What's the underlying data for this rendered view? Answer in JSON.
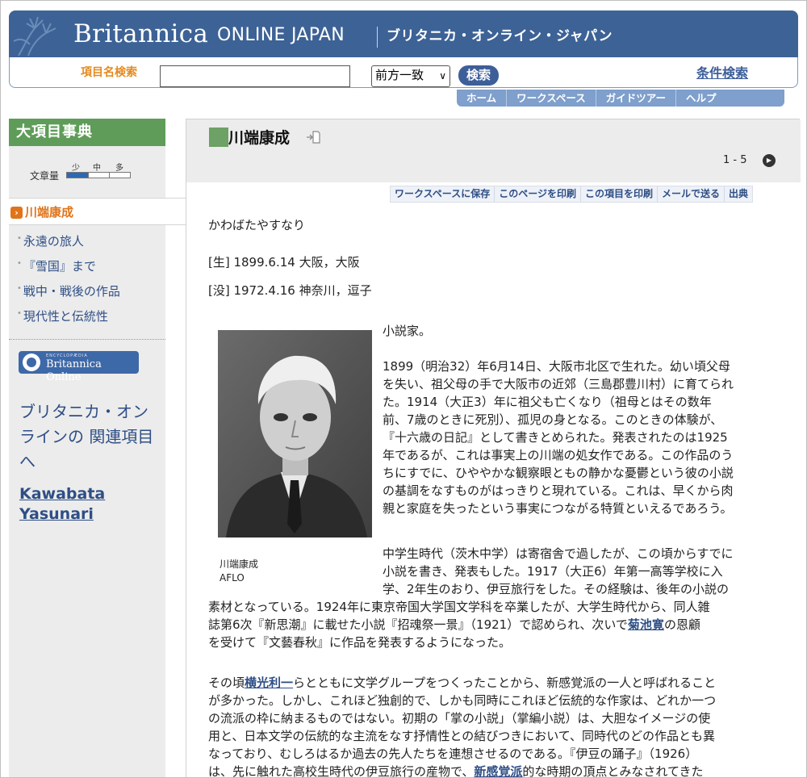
{
  "header": {
    "brand": "Britannica",
    "brand_sub": "ONLINE JAPAN",
    "brand_jp": "ブリタニカ・オンライン・ジャパン"
  },
  "search": {
    "label": "項目名検索",
    "value": "",
    "mode": "前方一致",
    "button": "検索",
    "advanced": "条件検索"
  },
  "nav": [
    "ホーム",
    "ワークスペース",
    "ガイドツアー",
    "ヘルプ"
  ],
  "sidebar": {
    "header": "大項目事典",
    "volume_label": "文章量",
    "volume_marks": [
      "少",
      "中",
      "多"
    ],
    "volume_level": 0.33,
    "current": "川端康成",
    "items": [
      "永遠の旅人",
      "『雪国』まで",
      "戦中・戦後の作品",
      "現代性と伝統性"
    ],
    "logo_small": "ENCYCLOPÆDIA",
    "logo_text": "Britannica Online",
    "related_text": "ブリタニカ・オンラインの 関連項目へ",
    "english_link": "Kawabata Yasunari"
  },
  "article": {
    "title": "川端康成",
    "pager": "1 - 5",
    "actions": [
      "ワークスペースに保存",
      "このページを印刷",
      "この項目を印刷",
      "メールで送る",
      "出典"
    ],
    "reading": "かわばたやすなり",
    "born": "[生] 1899.6.14 大阪，大阪",
    "died": "[没] 1972.4.16 神奈川，逗子",
    "caption_name": "川端康成",
    "caption_credit": "AFLO",
    "p0": "小説家。",
    "p1_lines": [
      "1899（明治32）年6月14日、大阪市北区で生れた。幼い頃父母",
      "を失い、祖父母の手で大阪市の近郊（三島郡豊川村）に育てられ",
      "た。1914（大正3）年に祖父も亡くなり（祖母とはその数年",
      "前、7歳のときに死別）、孤児の身となる。このときの体験が、",
      "『十六歳の日記』として書きとめられた。発表されたのは1925",
      "年であるが、これは事実上の川端の処女作である。この作品のう",
      "ちにすでに、ひややかな観察眼ともの静かな憂鬱という彼の小説",
      "の基調をなすものがはっきりと現れている。これは、早くから肉",
      "親と家庭を失ったという事実につながる特質といえるであろう。"
    ],
    "p2_lines": [
      "中学生時代（茨木中学）は寄宿舎で過したが、この頃からすでに",
      "小説を書き、発表もした。1917（大正6）年第一高等学校に入",
      "学、2年生のおり、伊豆旅行をした。その経験は、後年の小説の",
      "素材となっている。1924年に東京帝国大学国文学科を卒業したが、大学生時代から、同人雑",
      "誌第6次『新思潮』に載せた小説『招魂祭一景』（1921）で認められ、次いで",
      "を受けて『文藝春秋』に作品を発表するようになった。"
    ],
    "p2_link": "菊池寛",
    "p2_after_link": "の恩顧",
    "p3_pre": "その頃",
    "p3_link": "横光利一",
    "p3_post": "らとともに文学グループをつくったことから、新感覚派の一人と呼ばれること",
    "p3_lines": [
      "が多かった。しかし、これほど独創的で、しかも同時にこれほど伝統的な作家は、どれか一つ",
      "の流派の枠に納まるものではない。初期の「掌の小説」（掌編小説）は、大胆なイメージの使",
      "用と、日本文学の伝統的な主流をなす抒情性との結びつきにおいて、同時代のどの作品とも異",
      "なっており、むしろはるか過去の先人たちを連想させるのである。『伊豆の踊子』（1926）"
    ],
    "p3_last_pre": "は、先に触れた高校生時代の伊豆旅行の産物で、",
    "p3_last_link": "新感覚派",
    "p3_last_post": "的な時期の頂点とみなされてきた"
  }
}
